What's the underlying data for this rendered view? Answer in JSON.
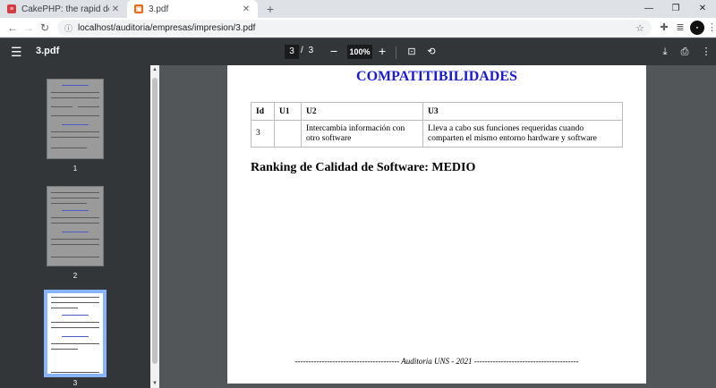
{
  "browser": {
    "tabs": [
      {
        "title": "CakePHP: the rapid development",
        "favicon": "cakephp-icon",
        "active": false
      },
      {
        "title": "3.pdf",
        "favicon": "pdf-icon",
        "active": true
      }
    ],
    "url": "localhost/auditoria/empresas/impresion/3.pdf"
  },
  "viewer": {
    "doc_name": "3.pdf",
    "current_page": "3",
    "total_pages": "3",
    "page_separator": "/",
    "zoom": "100%"
  },
  "thumbnails": [
    {
      "label": "1"
    },
    {
      "label": "2"
    },
    {
      "label": "3"
    }
  ],
  "document": {
    "title": "COMPATITIBILIDADES",
    "table": {
      "headers": [
        "Id",
        "U1",
        "U2",
        "U3"
      ],
      "rows": [
        [
          "3",
          "",
          "Intercambia información con otro software",
          "Lleva a cabo sus funciones requeridas cuando comparten el mismo entorno hardware y software"
        ]
      ]
    },
    "ranking": "Ranking de Calidad de Software: MEDIO",
    "footer": "--------------------------------------- Auditoria UNS - 2021 ---------------------------------------"
  },
  "colors": {
    "doc_title": "#1a1adb",
    "viewer_toolbar": "#323639",
    "viewer_background": "#525659",
    "thumbnail_highlight": "#8ab4f8"
  }
}
